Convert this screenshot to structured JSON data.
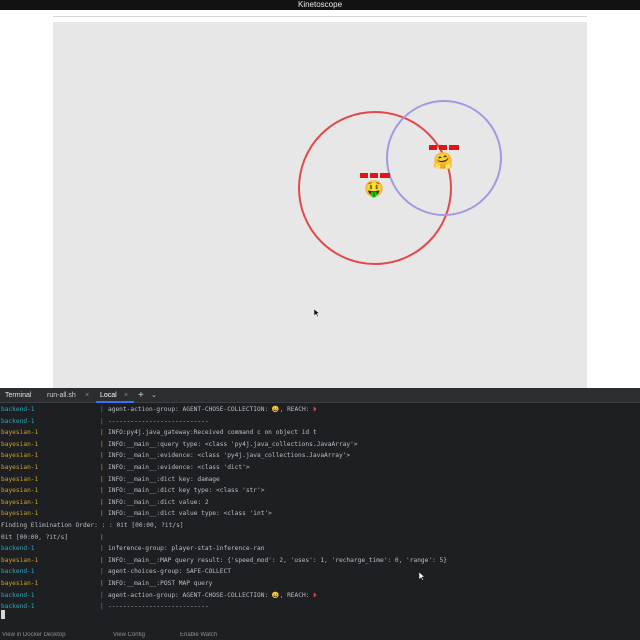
{
  "window": {
    "title": "Kinetoscope"
  },
  "game": {
    "agents": [
      {
        "id": "red",
        "emoji": "🤑",
        "range_color": "#e24a4a",
        "health_color": "#e01515"
      },
      {
        "id": "blue",
        "emoji": "🤗",
        "range_color": "#9f9be3",
        "health_color": "#e01515"
      }
    ],
    "background_color": "#e7e7e7"
  },
  "terminal": {
    "tabs": {
      "title": "Terminal",
      "run_all": "run-all.sh",
      "local": "Local",
      "close_glyph": "×",
      "add_glyph": "+",
      "dropdown_glyph": "⌄"
    },
    "lines": [
      {
        "service": "backend-1",
        "kind": "backend",
        "pipe": "|",
        "pre": "agent-action-group: AGENT-CHOSE-COLLECTION: 😀, REACH: ",
        "mark": "❥"
      },
      {
        "service": "backend-1",
        "kind": "backend",
        "pipe": "|",
        "pre": "---------------------------",
        "mark": ""
      },
      {
        "service": "bayesian-1",
        "kind": "bayesian",
        "pipe": "|",
        "pre": "INFO:py4j.java_gateway:Received command c on object id t",
        "mark": ""
      },
      {
        "service": "bayesian-1",
        "kind": "bayesian",
        "pipe": "|",
        "pre": "INFO:__main__:query type: <class 'py4j.java_collections.JavaArray'>",
        "mark": ""
      },
      {
        "service": "bayesian-1",
        "kind": "bayesian",
        "pipe": "|",
        "pre": "INFO:__main__:evidence: <class 'py4j.java_collections.JavaArray'>",
        "mark": ""
      },
      {
        "service": "bayesian-1",
        "kind": "bayesian",
        "pipe": "|",
        "pre": "INFO:__main__:evidence: <class 'dict'>",
        "mark": ""
      },
      {
        "service": "bayesian-1",
        "kind": "bayesian",
        "pipe": "|",
        "pre": "INFO:__main__:dict key: damage",
        "mark": ""
      },
      {
        "service": "bayesian-1",
        "kind": "bayesian",
        "pipe": "|",
        "pre": "INFO:__main__:dict key type: <class 'str'>",
        "mark": ""
      },
      {
        "service": "bayesian-1",
        "kind": "bayesian",
        "pipe": "|",
        "pre": "INFO:__main__:dict value: 2",
        "mark": ""
      },
      {
        "service": "bayesian-1",
        "kind": "bayesian",
        "pipe": "|",
        "pre": "INFO:__main__:dict value type: <class 'int'>",
        "mark": ""
      },
      {
        "service": "",
        "kind": "plain",
        "pipe": "",
        "pre": "Finding Elimination Order: : : 0it [00:00, ?it/s]",
        "mark": ""
      },
      {
        "service": "",
        "kind": "plain",
        "pipe": "",
        "pre": "0it [00:00, ?it/s]",
        "mark": "",
        "tail_pipe": "|"
      },
      {
        "service": "backend-1",
        "kind": "backend",
        "pipe": "|",
        "pre": "inference-group: player-stat-inference-ran",
        "mark": ""
      },
      {
        "service": "bayesian-1",
        "kind": "bayesian",
        "pipe": "|",
        "pre": "INFO:__main__:MAP query result: {'speed_mod': 2, 'uses': 1, 'recharge_time': 0, 'range': 5}",
        "mark": ""
      },
      {
        "service": "backend-1",
        "kind": "backend",
        "pipe": "|",
        "pre": "agent-choices-group: SAFE-COLLECT",
        "mark": ""
      },
      {
        "service": "bayesian-1",
        "kind": "bayesian",
        "pipe": "|",
        "pre": "INFO:__main__:POST MAP query",
        "mark": ""
      },
      {
        "service": "backend-1",
        "kind": "backend",
        "pipe": "|",
        "pre": "agent-action-group: AGENT-CHOSE-COLLECTION: 😀, REACH: ",
        "mark": "❥"
      },
      {
        "service": "backend-1",
        "kind": "backend",
        "pipe": "|",
        "pre": "---------------------------",
        "mark": ""
      }
    ],
    "status": {
      "docker": "View in Docker Desktop",
      "config": "View Config",
      "watch": "Enable Watch"
    },
    "colors": {
      "backend": "#2aa7b9",
      "bayesian": "#c9a227",
      "background": "#1e1f22"
    }
  }
}
